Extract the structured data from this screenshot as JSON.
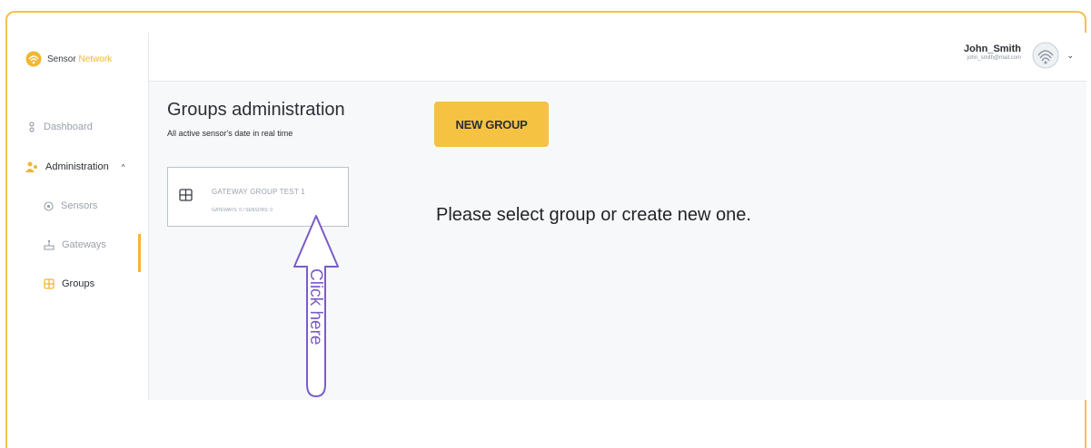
{
  "brand": {
    "name_part1": "Sensor",
    "name_part2": "Network",
    "accent": "#f2b632"
  },
  "sidebar": {
    "items": [
      {
        "label": "Dashboard",
        "icon": "dashboard-icon"
      },
      {
        "label": "Administration",
        "icon": "administration-icon",
        "expander": "^"
      },
      {
        "label": "Sensors",
        "icon": "sensor-icon"
      },
      {
        "label": "Gateways",
        "icon": "gateway-icon"
      },
      {
        "label": "Groups",
        "icon": "groups-icon",
        "active": true
      }
    ]
  },
  "header": {
    "user_name": "John_Smith",
    "user_email": "john_smith@mail.com",
    "chevron": "⌄"
  },
  "main": {
    "title": "Groups administration",
    "subtitle": "All active sensor's date in real time",
    "new_button": "NEW GROUP",
    "group_card": {
      "name": "GATEWAY GROUP TEST 1",
      "meta": "GATEWAYS: 0 / SENSORS: 0"
    },
    "prompt": "Please select group or create new one."
  },
  "annotation": {
    "text": "Click here",
    "color": "#7b5cc8"
  },
  "colors": {
    "button": "#f5c241",
    "frame": "#f2c14e",
    "main_bg": "#f7f8f9"
  }
}
